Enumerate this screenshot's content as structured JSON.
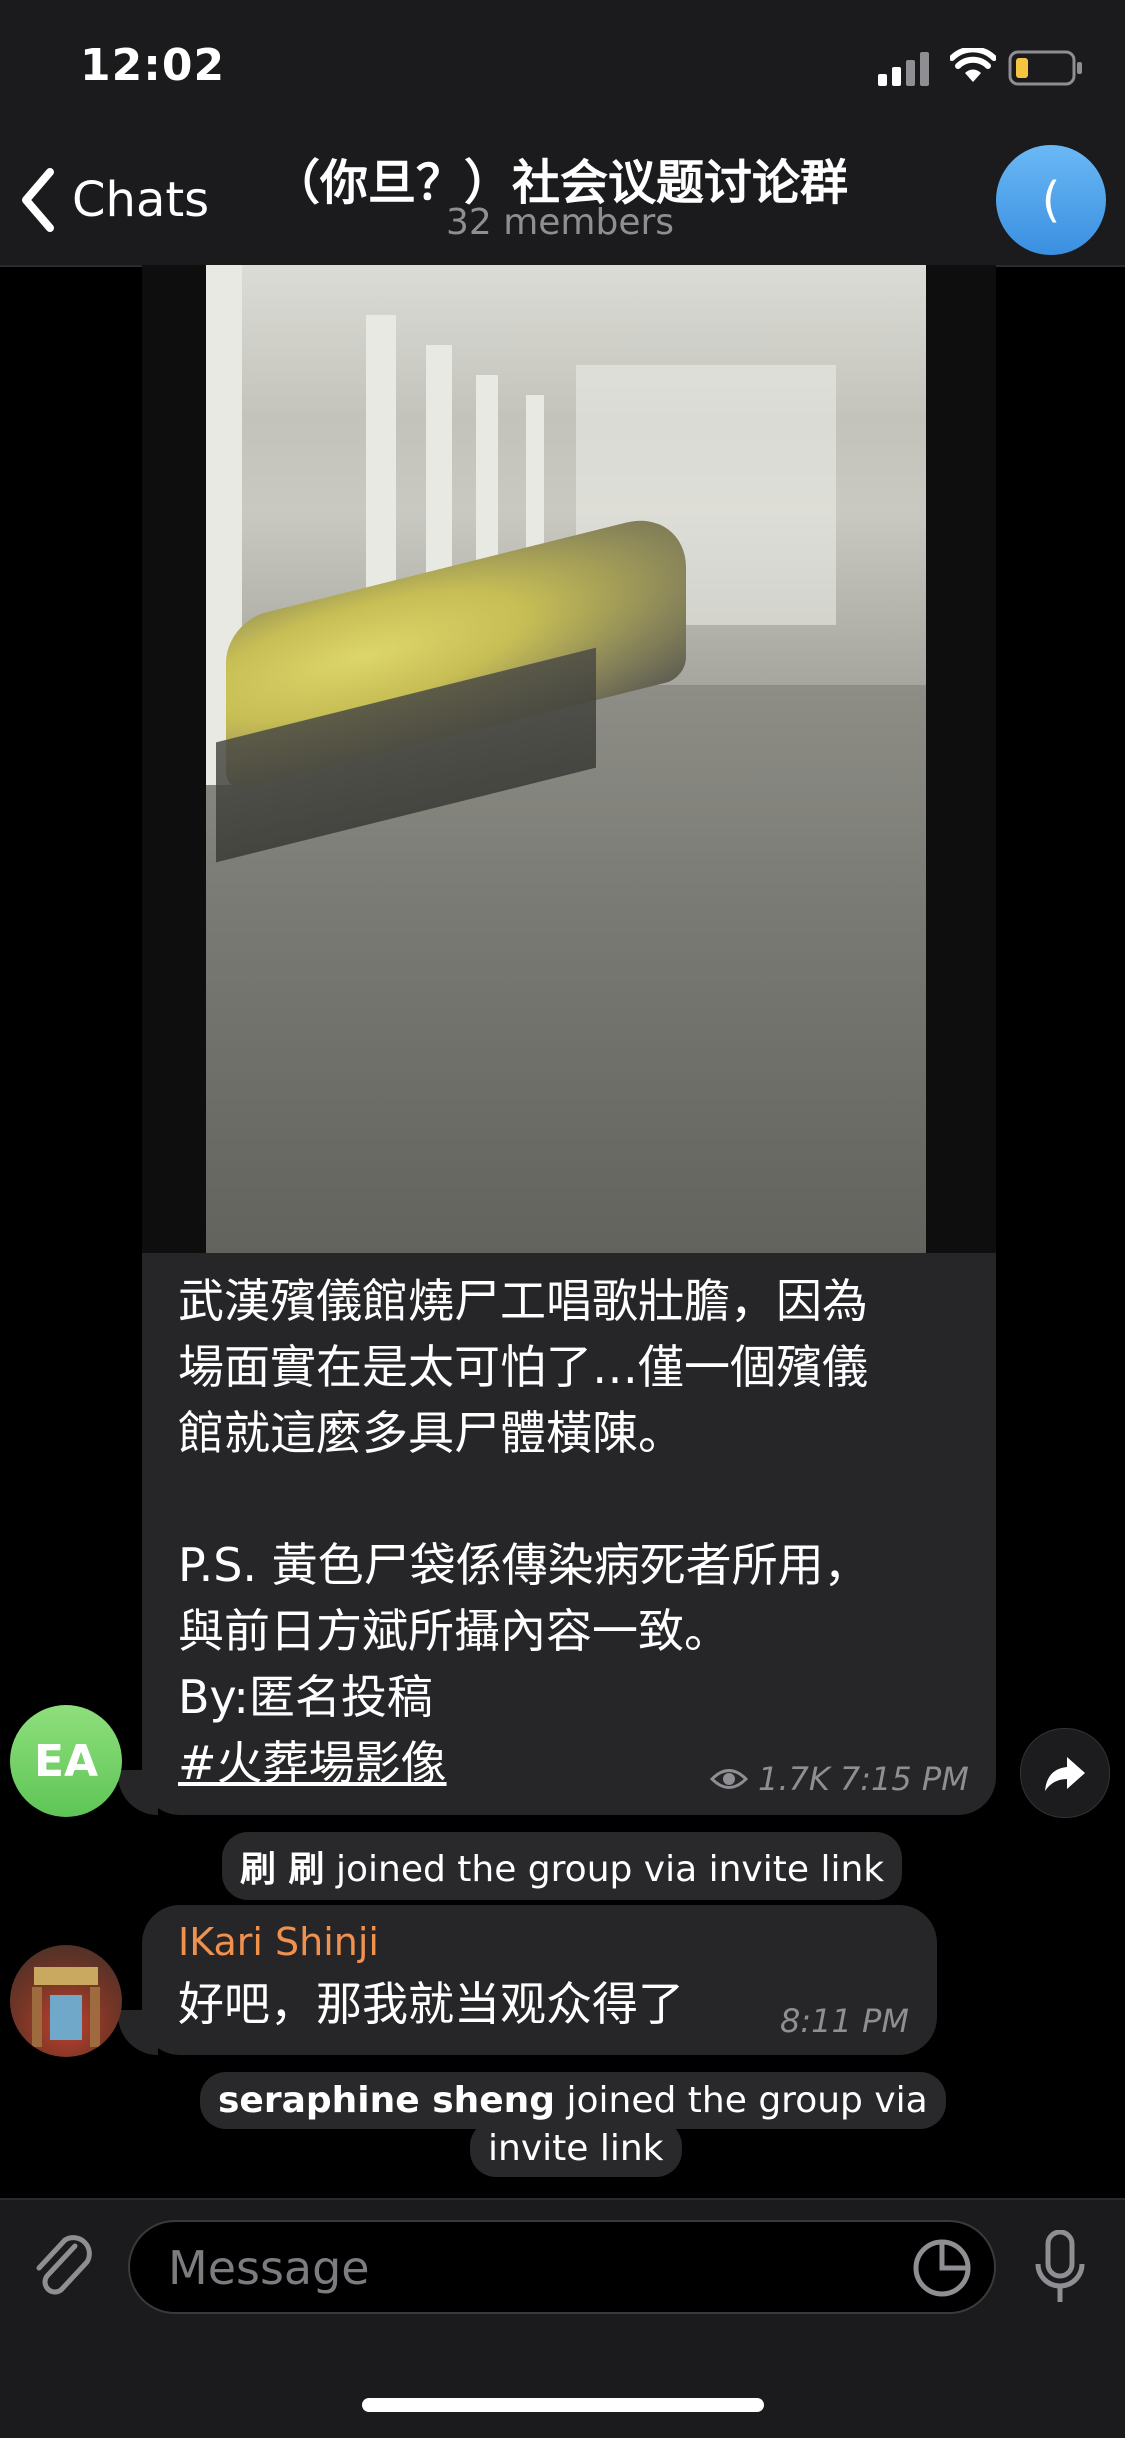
{
  "status_bar": {
    "time": "12:02",
    "battery_color": "#f5c542"
  },
  "nav": {
    "back_label": "Chats",
    "title": "（你旦？）社会议题讨论群",
    "subtitle": "32 members",
    "avatar_letter": "("
  },
  "messages": [
    {
      "type": "video_post",
      "avatar_initials": "EA",
      "text_lines": "武漢殯儀館燒尸工唱歌壯膽，因為\n場面實在是太可怕了…僅一個殯儀\n館就這麼多具尸體橫陳。\n\nP.S. 黃色尸袋係傳染病死者所用，\n與前日方斌所攝內容一致。\nBy:匿名投稿",
      "hashtag": "#火葬場影像",
      "views": "1.7K",
      "time": "7:15 PM"
    },
    {
      "type": "service",
      "name": "刷 刷",
      "text": " joined the group via invite link"
    },
    {
      "type": "text",
      "sender": "IKari Shinji",
      "sender_color": "#f0914d",
      "text": "好吧，那我就当观众得了",
      "time": "8:11 PM"
    },
    {
      "type": "service",
      "name": "seraphine sheng",
      "text_line1": " joined the group via",
      "text_line2": "invite link"
    }
  ],
  "input": {
    "placeholder": "Message"
  }
}
